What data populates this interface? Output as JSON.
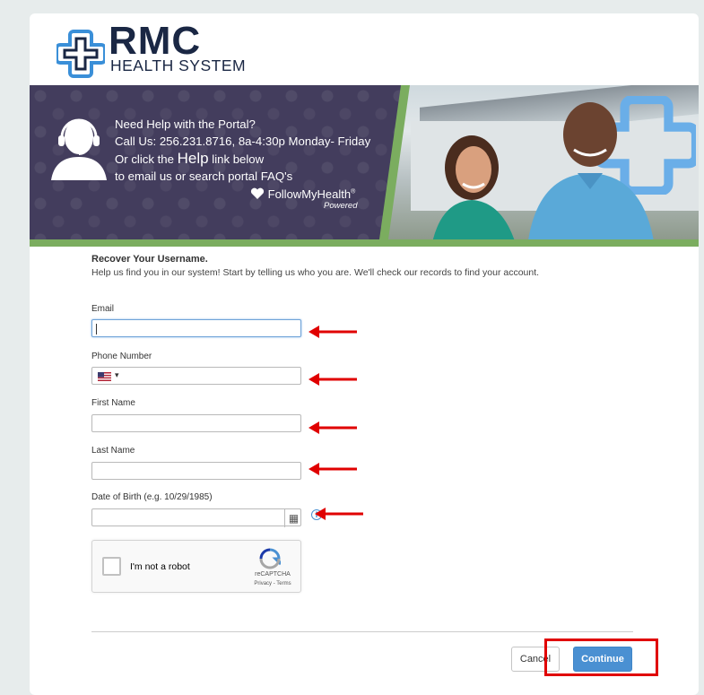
{
  "brand": {
    "name": "RMC",
    "subtitle": "HEALTH SYSTEM",
    "color": "#1a2744",
    "logo_color": "#3a8fd8"
  },
  "banner": {
    "line1": "Need Help with the Portal?",
    "line2": "Call Us: 256.231.8716, 8a-4:30p Monday- Friday",
    "line3_pre": "Or click the ",
    "line3_help": "Help",
    "line3_post": " link below",
    "line4": "to email us or search portal FAQ's",
    "partner": "FollowMyHealth",
    "partner_reg": "®",
    "partner_powered": "Powered"
  },
  "form": {
    "title": "Recover Your Username.",
    "subtitle": "Help us find you in our system! Start by telling us who you are. We'll check our records to find your account.",
    "email_label": "Email",
    "email_value": "",
    "phone_label": "Phone Number",
    "phone_country": "US",
    "phone_value": "",
    "first_name_label": "First Name",
    "first_name_value": "",
    "last_name_label": "Last Name",
    "last_name_value": "",
    "dob_label": "Date of Birth (e.g. 10/29/1985)",
    "dob_value": ""
  },
  "captcha": {
    "label": "I'm not a robot",
    "brand": "reCAPTCHA",
    "links": "Privacy - Terms"
  },
  "actions": {
    "cancel": "Cancel",
    "continue": "Continue"
  },
  "colors": {
    "accent_green": "#7bad5f",
    "banner_purple": "#433d5d",
    "continue_blue": "#4a90d2",
    "annotation_red": "#e00000"
  }
}
